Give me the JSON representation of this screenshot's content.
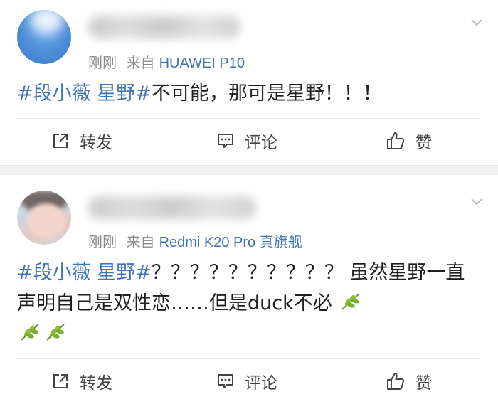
{
  "posts": [
    {
      "time": "刚刚",
      "source_prefix": "来自",
      "source_device": "HUAWEI P10",
      "content": {
        "tag": "#段小薇 星野#",
        "text": "不可能，那可是星野！！！"
      },
      "actions": {
        "forward": "转发",
        "comment": "评论",
        "like": "赞"
      }
    },
    {
      "time": "刚刚",
      "source_prefix": "来自",
      "source_device": "Redmi K20 Pro 真旗舰",
      "content": {
        "tag": "#段小薇 星野#",
        "text": "？？？？？？？？？？ 虽然星野一直声明自己是双性恋……但是duck不必"
      },
      "emoji_icon": "leaf-emoji-icon",
      "actions": {
        "forward": "转发",
        "comment": "评论",
        "like": "赞"
      }
    }
  ],
  "colors": {
    "link": "#3f74b7",
    "meta": "#8a8a8a",
    "separator": "#f2f2f2"
  }
}
